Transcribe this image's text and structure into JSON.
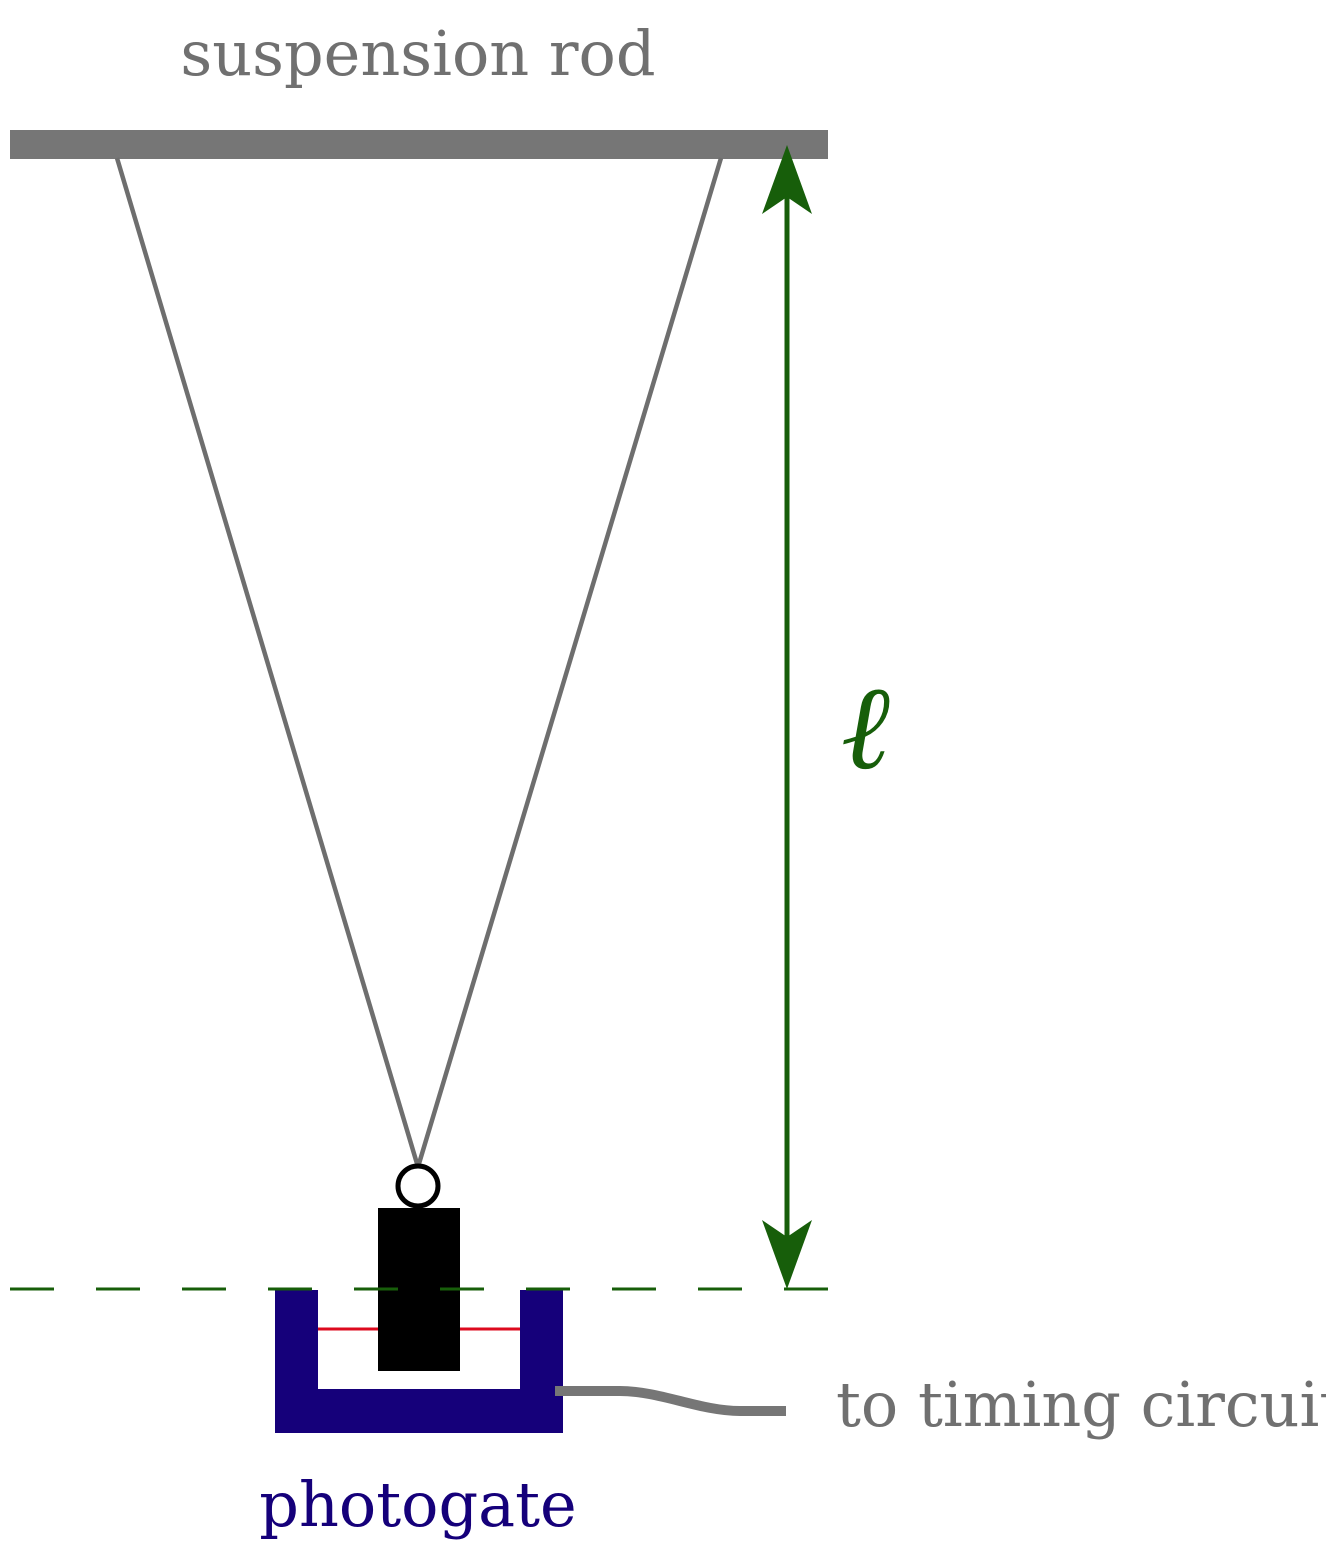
{
  "labels": {
    "suspension_rod": "suspension rod",
    "length_symbol": "ℓ",
    "timing_circuit": "to timing circuit",
    "photogate": "photogate"
  },
  "colors": {
    "rod": "#767676",
    "string": "#6e6e6e",
    "dimension": "#175e0a",
    "photogate": "#15007a",
    "beam": "#dd0a1e",
    "mass": "#000000",
    "cable": "#767676",
    "label_gray": "#707070"
  }
}
